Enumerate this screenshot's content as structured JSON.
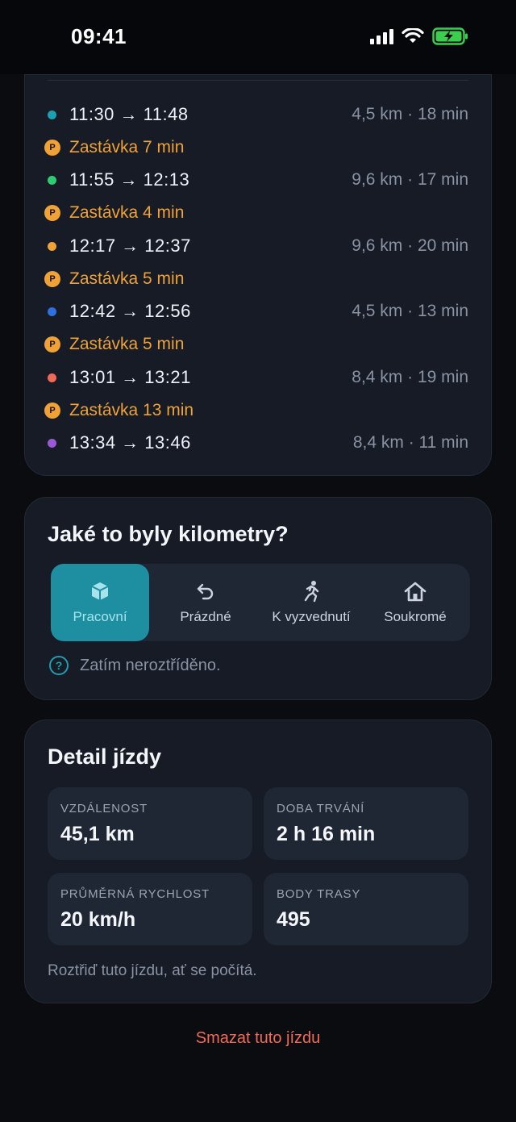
{
  "status_bar": {
    "time": "09:41"
  },
  "trips": [
    {
      "time": "11:30 → 11:48",
      "meta": "4,5 km · 18 min",
      "color": "#1aa0b2"
    },
    {
      "time": "11:55 → 12:13",
      "meta": "9,6 km · 17 min",
      "color": "#2ecc71"
    },
    {
      "time": "12:17 → 12:37",
      "meta": "9,6 km · 20 min",
      "color": "#f0a236"
    },
    {
      "time": "12:42 → 12:56",
      "meta": "4,5 km · 13 min",
      "color": "#2f6fe0"
    },
    {
      "time": "13:01 → 13:21",
      "meta": "8,4 km · 19 min",
      "color": "#f06a5a"
    },
    {
      "time": "13:34 → 13:46",
      "meta": "8,4 km · 11 min",
      "color": "#9b59d6"
    }
  ],
  "stops": [
    {
      "icon": "P",
      "label": "Zastávka 7 min"
    },
    {
      "icon": "P",
      "label": "Zastávka 4 min"
    },
    {
      "icon": "P",
      "label": "Zastávka 5 min"
    },
    {
      "icon": "P",
      "label": "Zastávka 5 min"
    },
    {
      "icon": "P",
      "label": "Zastávka 13 min"
    }
  ],
  "classification": {
    "title": "Jaké to byly kilometry?",
    "options": [
      {
        "label": "Pracovní",
        "icon": "box-icon",
        "selected": true
      },
      {
        "label": "Prázdné",
        "icon": "return-arrow-icon",
        "selected": false
      },
      {
        "label": "K vyzvednutí",
        "icon": "running-person-icon",
        "selected": false
      },
      {
        "label": "Soukromé",
        "icon": "house-icon",
        "selected": false
      }
    ],
    "hint": "Zatím neroztříděno.",
    "hint_icon": "?"
  },
  "detail": {
    "title": "Detail jízdy",
    "stats": [
      {
        "label": "VZDÁLENOST",
        "value": "45,1 km"
      },
      {
        "label": "DOBA TRVÁNÍ",
        "value": "2 h 16 min"
      },
      {
        "label": "PRŮMĚRNÁ RYCHLOST",
        "value": "20 km/h"
      },
      {
        "label": "BODY TRASY",
        "value": "495"
      }
    ],
    "note": "Roztřiď tuto jízdu, ať se počítá."
  },
  "actions": {
    "delete_label": "Smazat tuto jízdu"
  },
  "colors": {
    "accent": "#1e8fa0",
    "stop": "#f0a236",
    "danger": "#f06a5a"
  }
}
